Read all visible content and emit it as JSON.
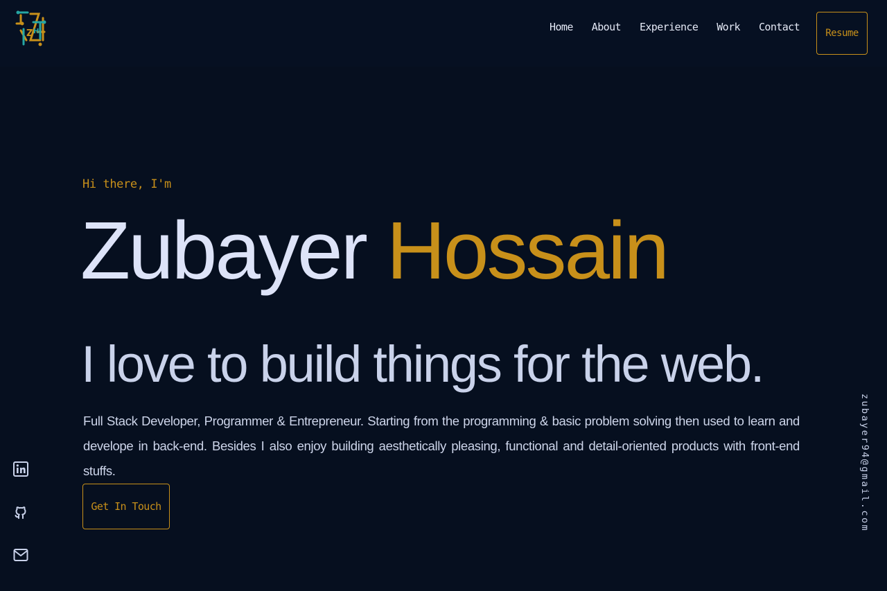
{
  "header": {
    "logo_icon": "zh-logo-icon",
    "nav": [
      {
        "label": "Home"
      },
      {
        "label": "About"
      },
      {
        "label": "Experience"
      },
      {
        "label": "Work"
      },
      {
        "label": "Contact"
      }
    ],
    "resume_label": "Resume"
  },
  "hero": {
    "greeting": "Hi there, I'm",
    "first_name": "Zubayer",
    "last_name": "Hossain",
    "tagline": "I love to build things for the web.",
    "bio": "Full Stack Developer, Programmer & Entrepreneur. Starting from the programming & basic problem solving then used to learn and develope in back-end. Besides I also enjoy building aesthetically pleasing, functional and detail-oriented products with front-end stuffs.",
    "cta_label": "Get In Touch"
  },
  "social": [
    {
      "icon": "linkedin-icon"
    },
    {
      "icon": "github-icon"
    },
    {
      "icon": "mail-icon"
    }
  ],
  "email": "zubayer94@gmail.com",
  "colors": {
    "background": "#060f1f",
    "accent": "#c8901a",
    "text": "#dce3f6"
  }
}
